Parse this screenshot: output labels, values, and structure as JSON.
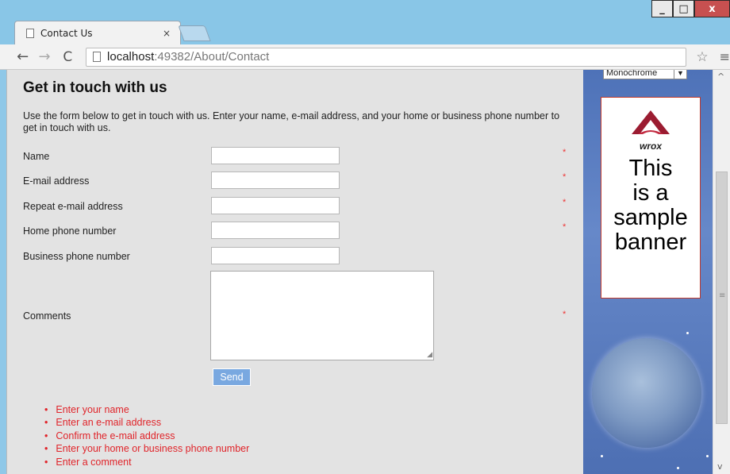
{
  "browser": {
    "tab_title": "Contact Us",
    "tab_close": "×",
    "url_host": "localhost",
    "url_path": ":49382/About/Contact",
    "window_controls": [
      "_",
      "□",
      "x"
    ]
  },
  "page": {
    "heading": "Get in touch with us",
    "intro": "Use the form below to get in touch with us. Enter your name, e-mail address, and your home or business phone number to get in touch with us.",
    "fields": {
      "name": {
        "label": "Name",
        "value": "",
        "required": "*"
      },
      "email": {
        "label": "E-mail address",
        "value": "",
        "required": "*"
      },
      "email_repeat": {
        "label": "Repeat e-mail address",
        "value": "",
        "required": "*"
      },
      "home_phone": {
        "label": "Home phone number",
        "value": "",
        "required": "*"
      },
      "business_phone": {
        "label": "Business phone number",
        "value": ""
      },
      "comments": {
        "label": "Comments",
        "value": "",
        "required": "*"
      }
    },
    "send_label": "Send",
    "errors": [
      "Enter your name",
      "Enter an e-mail address",
      "Confirm the e-mail address",
      "Enter your home or business phone number",
      "Enter a comment"
    ]
  },
  "sidebar": {
    "theme_select": "Monochrome",
    "banner_logo": "wrox",
    "banner_text_lines": [
      "This",
      "is a",
      "sample",
      "banner"
    ]
  },
  "colors": {
    "error": "#e0242a",
    "send_button": "#79a8e0",
    "sidebar_blue": "#5a7cc0",
    "wrox_red": "#9b1c31"
  }
}
